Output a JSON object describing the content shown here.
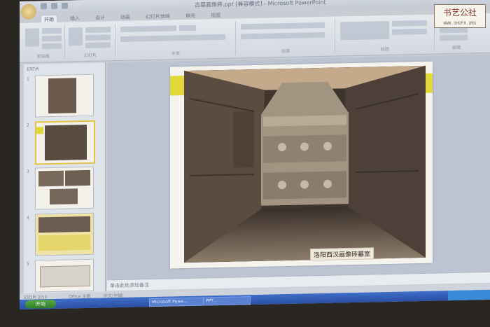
{
  "window": {
    "title": "古墓画像砖.ppt [兼容模式] - Microsoft PowerPoint"
  },
  "ribbon": {
    "tabs": [
      "开始",
      "插入",
      "设计",
      "动画",
      "幻灯片放映",
      "审阅",
      "视图"
    ],
    "groups": [
      "剪贴板",
      "幻灯片",
      "字体",
      "段落",
      "绘图",
      "编辑"
    ]
  },
  "slides_pane": {
    "tab_label": "幻灯片",
    "slide_numbers": [
      "1",
      "2",
      "3",
      "4",
      "5"
    ],
    "selected": 2
  },
  "slide": {
    "caption": "洛阳西汉画像砖墓室"
  },
  "notes": {
    "placeholder": "单击此处添加备注"
  },
  "status": {
    "slide_counter": "幻灯片 2/10",
    "theme": "Office 主题",
    "language": "中文(中国)"
  },
  "taskbar": {
    "start": "开始",
    "tasks": [
      "Microsoft Powe...",
      "PPT..."
    ]
  },
  "watermark": {
    "main": "书艺公社",
    "url": "WWW.SHUFA.ORG"
  },
  "colors": {
    "accent": "#e2d838",
    "taskbar": "#2a4fa3",
    "ribbon": "#dfe3ea"
  }
}
